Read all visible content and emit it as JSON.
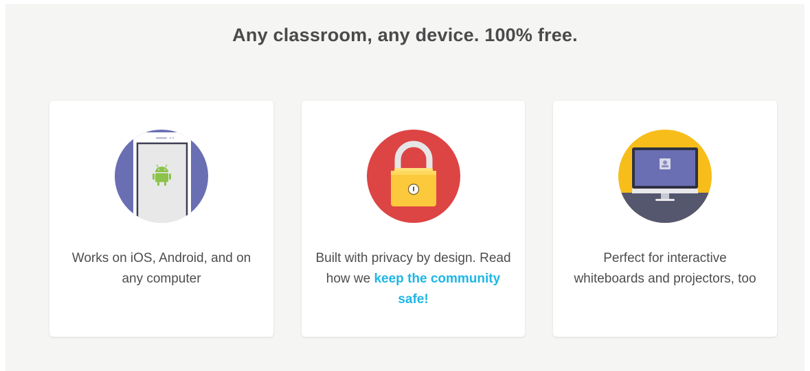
{
  "headline": "Any classroom, any device. 100% free.",
  "colors": {
    "background": "#f5f5f4",
    "card": "#ffffff",
    "text": "#4d4d4d",
    "headline": "#4a4a4a",
    "link": "#1eb6e6",
    "device_circle": "#6a6fb3",
    "privacy_circle": "#dd4444",
    "whiteboard_circle": "#f7bd1b"
  },
  "cards": [
    {
      "icon": "android-phone-icon",
      "text": "Works on iOS, Android, and on any computer"
    },
    {
      "icon": "padlock-icon",
      "text_before": "Built with privacy by design. Read how we ",
      "link_text": "keep the community safe!"
    },
    {
      "icon": "monitor-icon",
      "text": "Perfect for interactive whiteboards and projectors, too"
    }
  ]
}
